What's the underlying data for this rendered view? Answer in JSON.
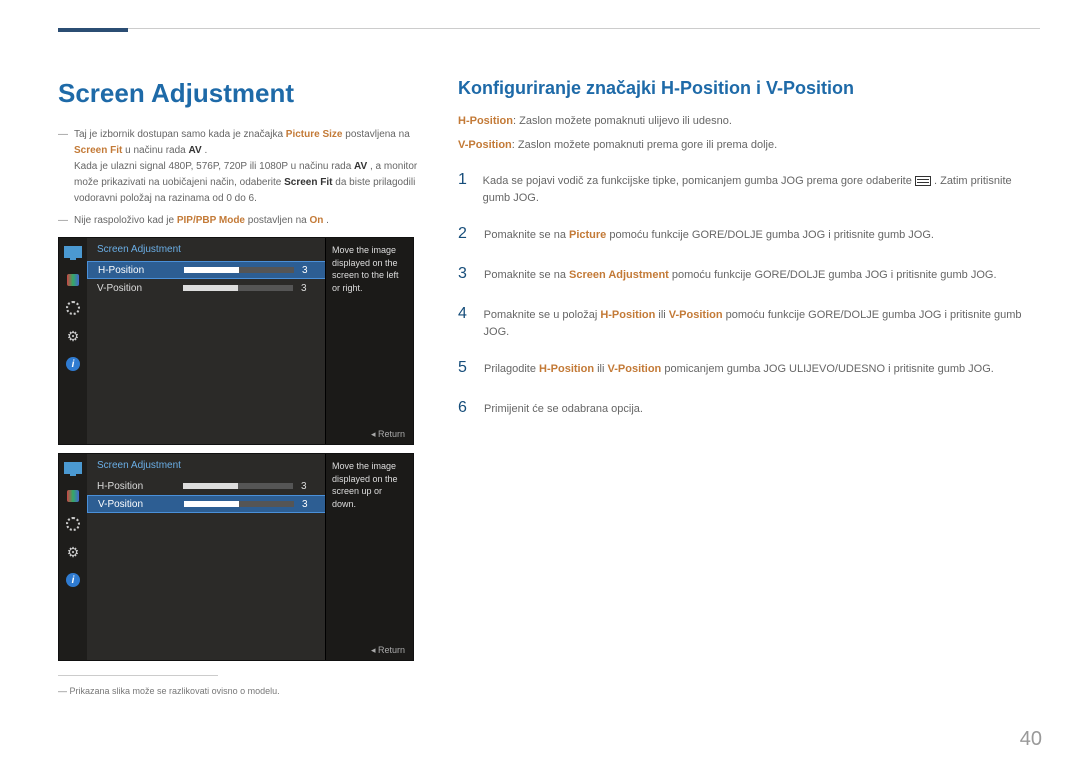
{
  "page_number": "40",
  "left": {
    "title": "Screen Adjustment",
    "notes": [
      {
        "pre": "Taj je izbornik dostupan samo kada je značajka ",
        "bold1": "Picture Size",
        "mid1": " postavljena na ",
        "bold2": "Screen Fit",
        "mid2": " u načinu rada ",
        "bold3": "AV",
        "post": "."
      },
      {
        "full_pre": "Kada je ulazni signal 480P, 576P, 720P ili 1080P u načinu rada ",
        "full_b1": "AV",
        "full_mid": ", a monitor može prikazivati na uobičajeni način, odaberite ",
        "full_b2": "Screen Fit",
        "full_post": " da biste prilagodili vodoravni položaj na razinama od 0 do 6."
      },
      {
        "n2_pre": "Nije raspoloživo kad je ",
        "n2_b1": "PIP/PBP Mode",
        "n2_mid": " postavljen na ",
        "n2_b2": "On",
        "n2_post": "."
      }
    ],
    "osd": {
      "title": "Screen Adjustment",
      "hpos": "H-Position",
      "vpos": "V-Position",
      "val": "3",
      "desc1": "Move the image displayed on the screen to the left or right.",
      "desc2": "Move the image displayed on the screen up or down.",
      "return": "Return"
    },
    "image_note": "Prikazana slika može se razlikovati ovisno o modelu."
  },
  "right": {
    "title": "Konfiguriranje značajki H-Position i V-Position",
    "intro1_b": "H-Position",
    "intro1_t": ": Zaslon možete pomaknuti ulijevo ili udesno.",
    "intro2_b": "V-Position",
    "intro2_t": ": Zaslon možete pomaknuti prema gore ili prema dolje.",
    "steps": [
      {
        "pre": "Kada se pojavi vodič za funkcijske tipke, pomicanjem gumba JOG prema gore odaberite ",
        "post": ". Zatim pritisnite gumb JOG."
      },
      {
        "pre": "Pomaknite se na ",
        "b": "Picture",
        "post": " pomoću funkcije GORE/DOLJE gumba JOG i pritisnite gumb JOG."
      },
      {
        "pre": "Pomaknite se na ",
        "b": "Screen Adjustment",
        "post": " pomoću funkcije GORE/DOLJE gumba JOG i pritisnite gumb JOG."
      },
      {
        "pre": "Pomaknite se u položaj ",
        "b1": "H-Position",
        "mid": " ili ",
        "b2": "V-Position",
        "post": " pomoću funkcije GORE/DOLJE gumba JOG i pritisnite gumb JOG."
      },
      {
        "pre": "Prilagodite ",
        "b1": "H-Position",
        "mid": " ili ",
        "b2": "V-Position",
        "post": " pomicanjem gumba JOG ULIJEVO/UDESNO i pritisnite gumb JOG."
      },
      {
        "pre": "Primijenit će se odabrana opcija."
      }
    ]
  }
}
